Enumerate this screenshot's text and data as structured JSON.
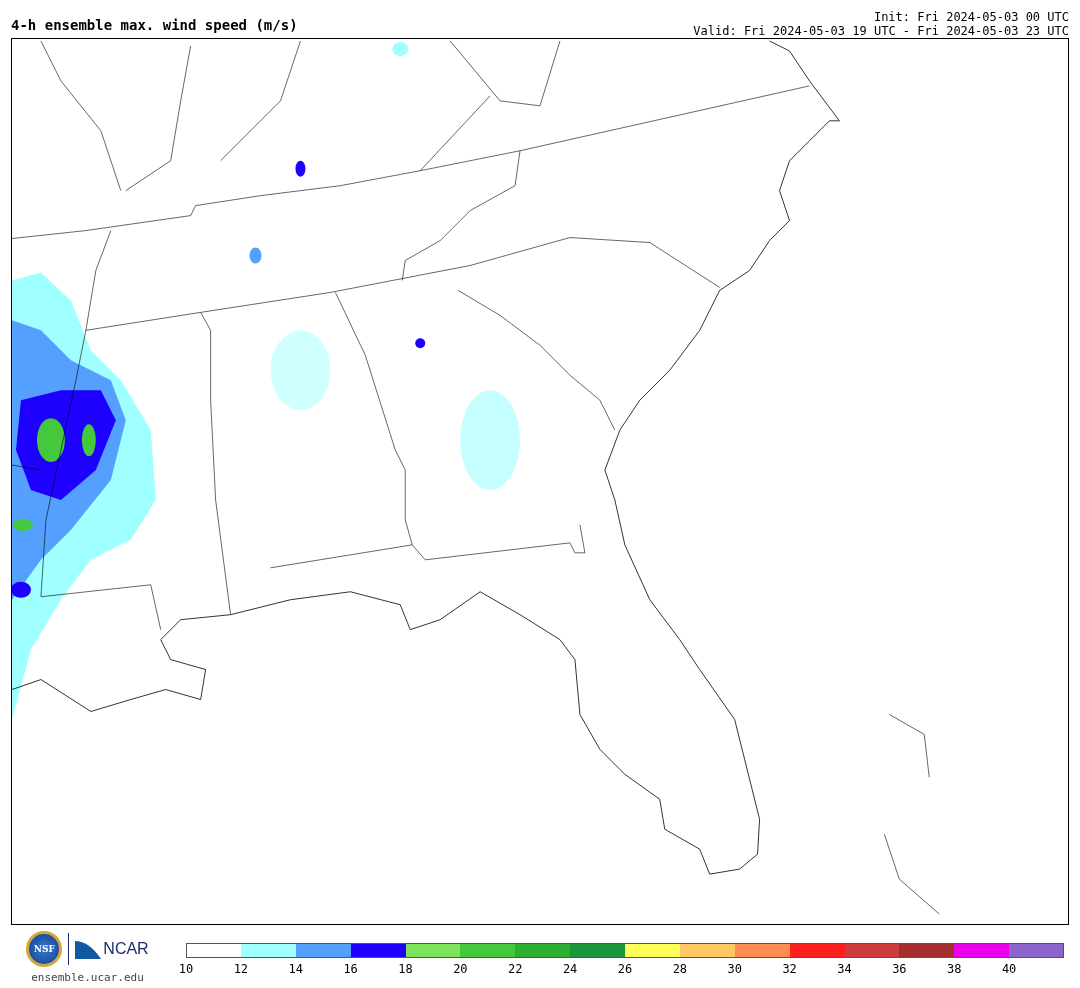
{
  "title": "4-h ensemble max. wind speed (m/s)",
  "init": "Init: Fri 2024-05-03 00 UTC",
  "valid": "Valid: Fri 2024-05-03 19 UTC - Fri 2024-05-03 23 UTC",
  "logos": {
    "nsf": "NSF",
    "ncar": "NCAR",
    "site": "ensemble.ucar.edu"
  },
  "colorbar": {
    "bins": [
      {
        "color": "#ffffff"
      },
      {
        "color": "#a0ffff"
      },
      {
        "color": "#55a0ff"
      },
      {
        "color": "#1e00ff"
      },
      {
        "color": "#7de35a"
      },
      {
        "color": "#46c83c"
      },
      {
        "color": "#2daf32"
      },
      {
        "color": "#1e963c"
      },
      {
        "color": "#ffff5a"
      },
      {
        "color": "#ffc864"
      },
      {
        "color": "#ff8c50"
      },
      {
        "color": "#ff1e1e"
      },
      {
        "color": "#cd3c3c"
      },
      {
        "color": "#a52d2d"
      },
      {
        "color": "#eb00eb"
      },
      {
        "color": "#8c64cd"
      }
    ],
    "ticks": [
      "10",
      "12",
      "14",
      "16",
      "18",
      "20",
      "22",
      "24",
      "26",
      "28",
      "30",
      "32",
      "34",
      "36",
      "38",
      "40"
    ]
  }
}
